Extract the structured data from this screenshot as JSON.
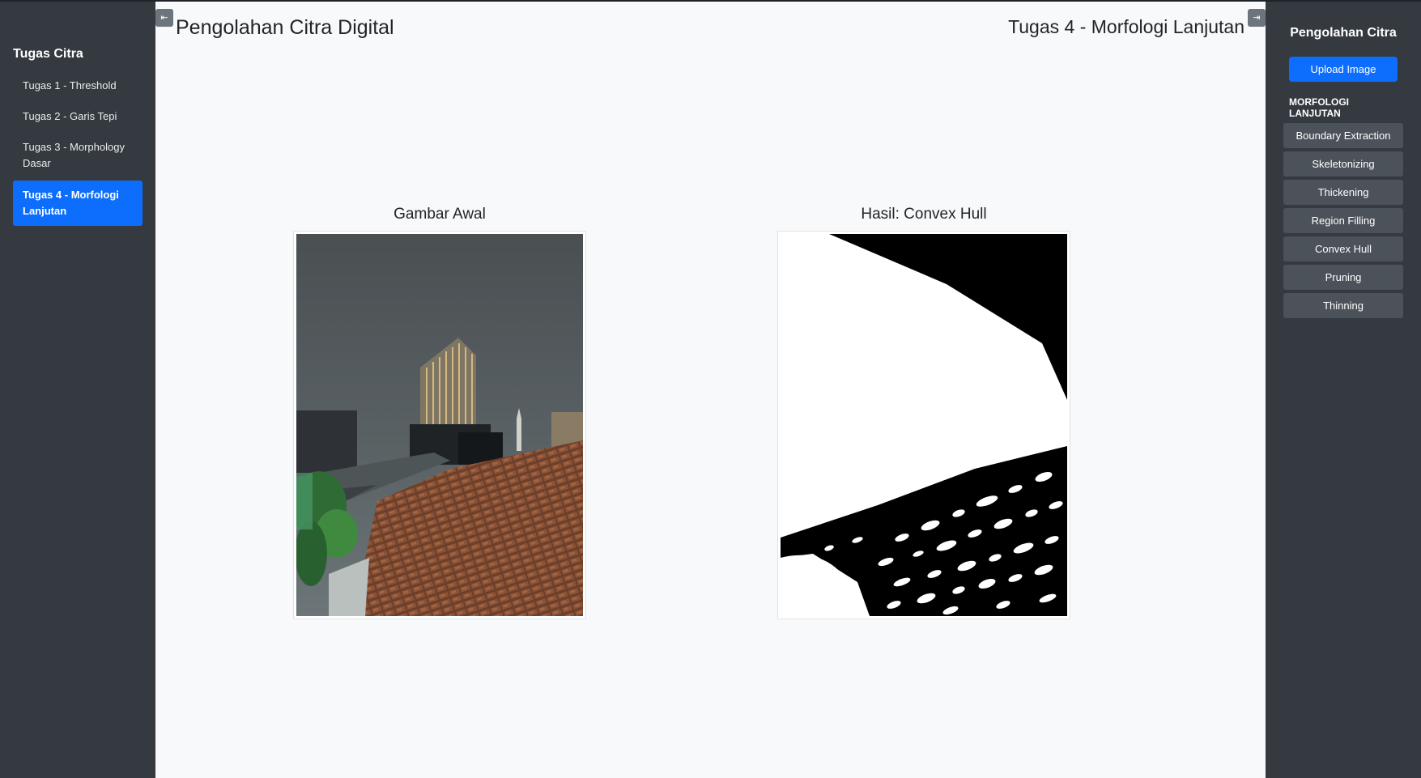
{
  "left_sidebar": {
    "title": "Tugas Citra",
    "items": [
      {
        "label": "Tugas 1 - Threshold",
        "active": false
      },
      {
        "label": "Tugas 2 - Garis Tepi",
        "active": false
      },
      {
        "label": "Tugas 3 - Morphology Dasar",
        "active": false
      },
      {
        "label": "Tugas 4 - Morfologi Lanjutan",
        "active": true
      }
    ]
  },
  "header": {
    "title": "Pengolahan Citra Digital",
    "assignment": "Tugas 4 - Morfologi Lanjutan",
    "toggle_left_icon": "collapse-left-icon",
    "toggle_right_icon": "collapse-right-icon"
  },
  "images": {
    "original_caption": "Gambar Awal",
    "result_caption": "Hasil: Convex Hull"
  },
  "right_sidebar": {
    "title": "Pengolahan Citra",
    "upload_label": "Upload Image",
    "section_label": "MORFOLOGI LANJUTAN",
    "operations": [
      "Boundary Extraction",
      "Skeletonizing",
      "Thickening",
      "Region Filling",
      "Convex Hull",
      "Pruning",
      "Thinning"
    ]
  },
  "colors": {
    "sidebar_bg": "#343a40",
    "accent": "#0d6efd",
    "button_bg": "#4b5259",
    "main_bg": "#f8f9fa"
  }
}
